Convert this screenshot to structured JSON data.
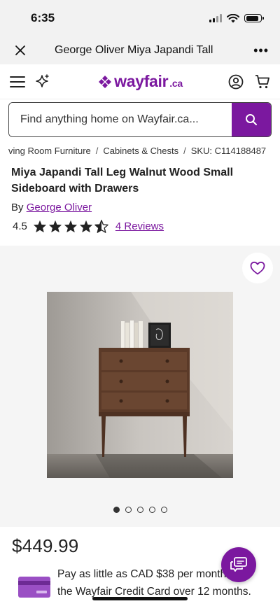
{
  "status": {
    "time": "6:35"
  },
  "browser": {
    "title": "George Oliver Miya Japandi Tall",
    "more": "•••"
  },
  "header": {
    "logo": "wayfair",
    "logo_suffix": ".ca"
  },
  "search": {
    "placeholder": "Find anything home on Wayfair.ca..."
  },
  "breadcrumb": {
    "items": [
      "ving Room Furniture",
      "Cabinets & Chests"
    ],
    "separator": "/",
    "sku": "SKU: C114188487"
  },
  "product": {
    "title": "Miya Japandi Tall Leg Walnut Wood Small Sideboard with Drawers",
    "by_label": "By",
    "brand": "George Oliver",
    "rating": "4.5",
    "rating_value": 4.5,
    "rating_max": 5,
    "reviews": "4 Reviews",
    "price": "$449.99",
    "image_count": 5,
    "active_image": 0
  },
  "financing": {
    "line1": "Pay as little as CAD $38 per month with",
    "line2": "the Wayfair Credit Card over 12 months."
  },
  "colors": {
    "brand": "#7b189f"
  }
}
